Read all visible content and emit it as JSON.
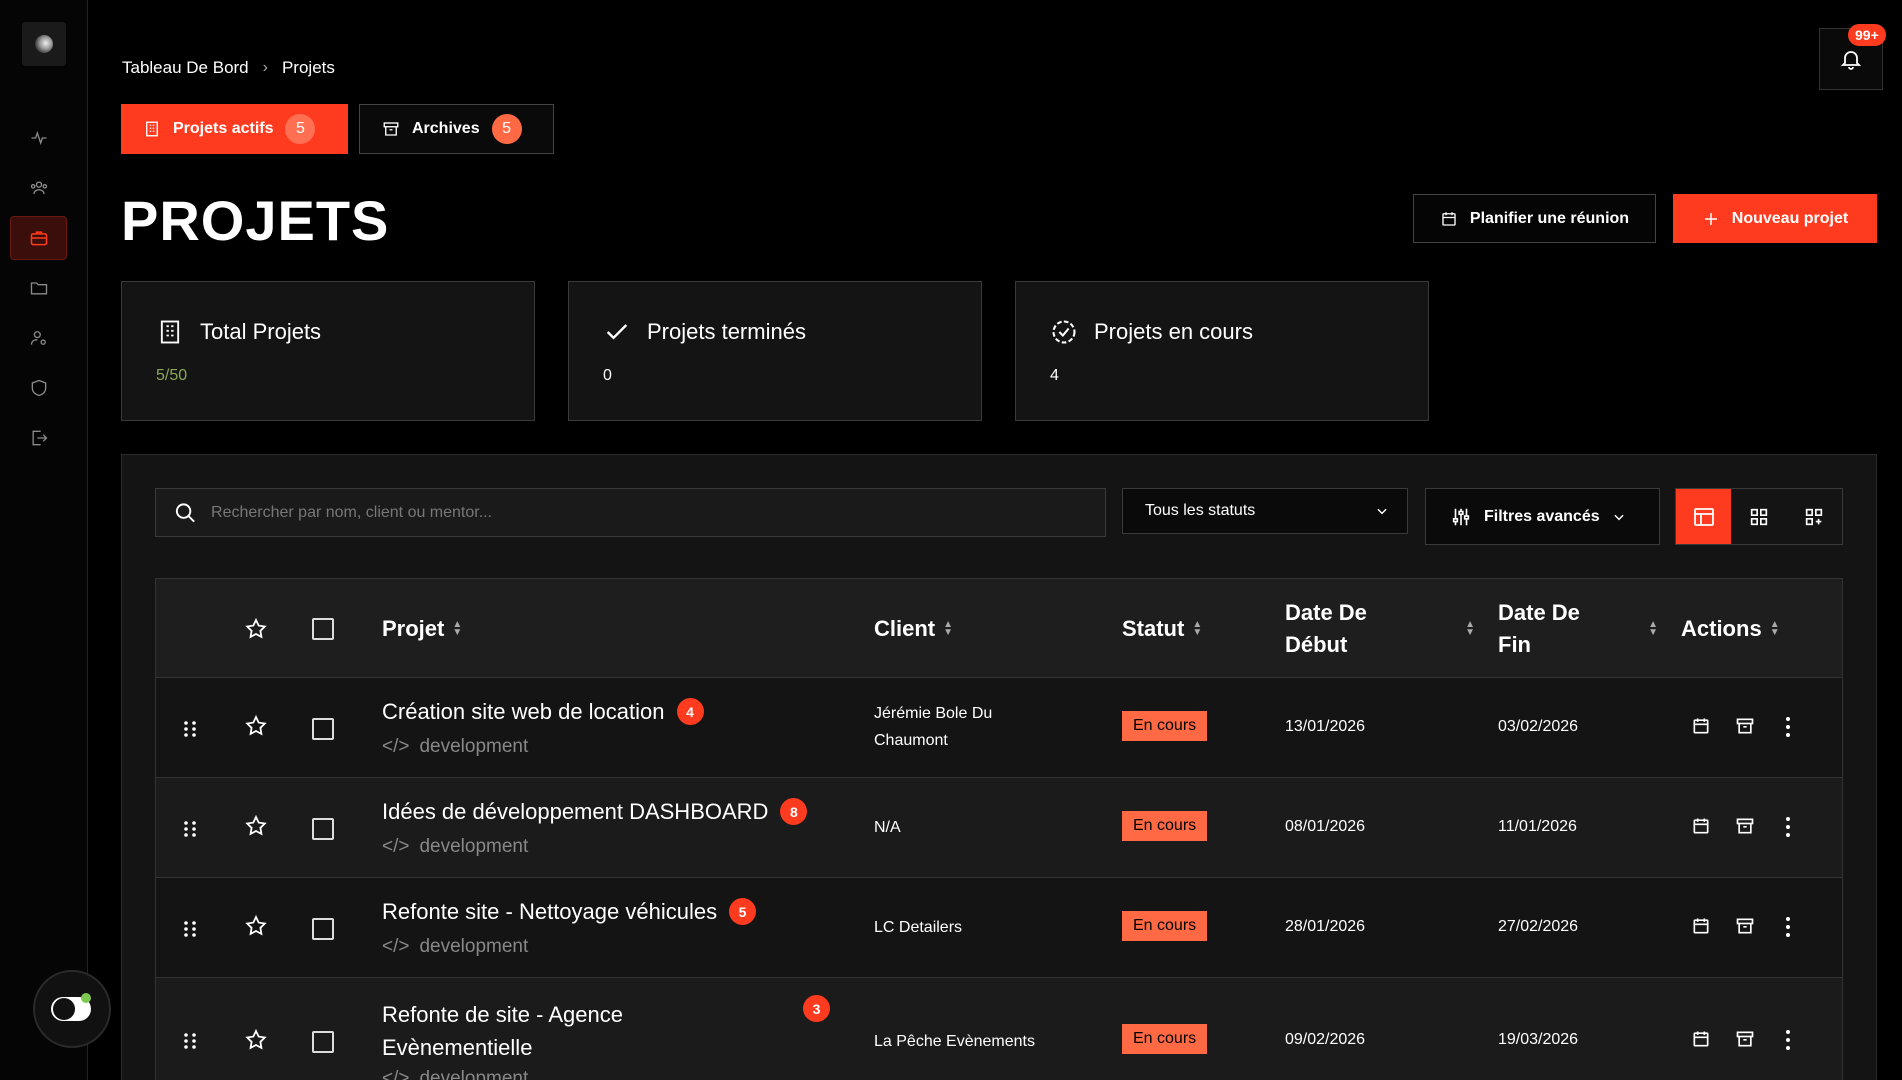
{
  "breadcrumb": {
    "root": "Tableau De Bord",
    "current": "Projets"
  },
  "notifications": {
    "count": "99+"
  },
  "tabs": [
    {
      "label": "Projets actifs",
      "count": "5"
    },
    {
      "label": "Archives",
      "count": "5"
    }
  ],
  "page": {
    "title": "PROJETS"
  },
  "actions": {
    "schedule": "Planifier une réunion",
    "new_project": "Nouveau projet"
  },
  "stats": [
    {
      "label": "Total Projets",
      "value": "5/50"
    },
    {
      "label": "Projets terminés",
      "value": "0"
    },
    {
      "label": "Projets en cours",
      "value": "4"
    }
  ],
  "toolbar": {
    "search_placeholder": "Rechercher par nom, client ou mentor...",
    "status_filter": "Tous les statuts",
    "advanced_filters": "Filtres avancés"
  },
  "table": {
    "headers": {
      "project": "Projet",
      "client": "Client",
      "status": "Statut",
      "start_a": "Date De",
      "start_b": "Début",
      "end_a": "Date De",
      "end_b": "Fin",
      "actions": "Actions"
    },
    "rows": [
      {
        "name": "Création site web de location",
        "count": "4",
        "tag": "development",
        "client_a": "Jérémie Bole Du",
        "client_b": "Chaumont",
        "status": "En cours",
        "start": "13/01/2026",
        "end": "03/02/2026"
      },
      {
        "name": "Idées de développement DASHBOARD",
        "count": "8",
        "tag": "development",
        "client_a": "N/A",
        "client_b": "",
        "status": "En cours",
        "start": "08/01/2026",
        "end": "11/01/2026"
      },
      {
        "name": "Refonte site - Nettoyage véhicules",
        "count": "5",
        "tag": "development",
        "client_a": "LC Detailers",
        "client_b": "",
        "status": "En cours",
        "start": "28/01/2026",
        "end": "27/02/2026"
      },
      {
        "name_a": "Refonte de site - Agence",
        "name_b": "Evènementielle",
        "count": "3",
        "tag": "development",
        "client_a": "La Pêche Evènements",
        "client_b": "",
        "status": "En cours",
        "start": "09/02/2026",
        "end": "19/03/2026"
      }
    ]
  },
  "colors": {
    "accent": "#ff3b1f",
    "status_bg": "#ff6a45",
    "success_text": "#8aa85a"
  }
}
